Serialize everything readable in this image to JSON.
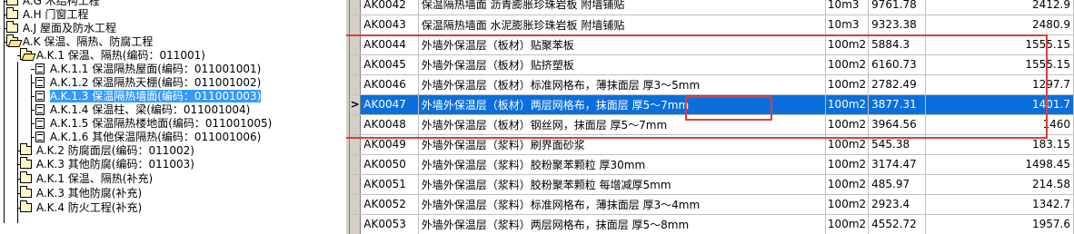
{
  "tree": {
    "items": [
      {
        "label": "A.G 木结构工程",
        "icon": "folder-icon"
      },
      {
        "label": "A.H 门窗工程",
        "icon": "folder-icon"
      },
      {
        "label": "A.J 屋面及防水工程",
        "icon": "folder-icon"
      },
      {
        "label": "A.K 保温、隔热、防腐工程",
        "icon": "folder-open-icon"
      },
      {
        "label": "A.K.1 保温、隔热(编码：011001)",
        "icon": "folder-open-icon"
      },
      {
        "label": "A.K.1.1 保温隔热屋面(编码：011001001)",
        "icon": "document-icon"
      },
      {
        "label": "A.K.1.2 保温隔热天棚(编码：011001002)",
        "icon": "document-icon"
      },
      {
        "label": "A.K.1.3 保温隔热墙面(编码：011001003)",
        "icon": "document-icon",
        "selected": true
      },
      {
        "label": "A.K.1.4 保温柱、梁(编码：011001004)",
        "icon": "document-icon"
      },
      {
        "label": "A.K.1.5 保温隔热楼地面(编码：011001005)",
        "icon": "document-icon"
      },
      {
        "label": "A.K.1.6 其他保温隔热(编码：011001006)",
        "icon": "document-icon"
      },
      {
        "label": "A.K.2 防腐面层(编码：011002)",
        "icon": "folder-icon"
      },
      {
        "label": "A.K.3 其他防腐(编码：011003)",
        "icon": "folder-icon"
      },
      {
        "label": "A.K.1 保温、隔热(补充)",
        "icon": "folder-icon"
      },
      {
        "label": "A.K.3 其他防腐(补充)",
        "icon": "folder-icon"
      },
      {
        "label": "A.K.4 防火工程(补充)",
        "icon": "folder-icon"
      }
    ]
  },
  "grid": {
    "rows": [
      {
        "indicator": "",
        "code": "AK0042",
        "name": "保温隔热墙面 沥青膨胀珍珠岩板 附墙铺贴",
        "unit": "10m3",
        "price": "9761.78",
        "value": "2412.9"
      },
      {
        "indicator": "",
        "code": "AK0043",
        "name": "保温隔热墙面 水泥膨胀珍珠岩板 附墙铺贴",
        "unit": "10m3",
        "price": "9323.38",
        "value": "2480.9"
      },
      {
        "indicator": "",
        "code": "AK0044",
        "name": "外墙外保温层（板材）贴聚苯板",
        "unit": "100m2",
        "price": "5884.3",
        "value": "1555.15"
      },
      {
        "indicator": "",
        "code": "AK0045",
        "name": "外墙外保温层（板材）贴挤塑板",
        "unit": "100m2",
        "price": "6160.73",
        "value": "1555.15"
      },
      {
        "indicator": "",
        "code": "AK0046",
        "name": "外墙外保温层（板材）标准网格布，薄抹面层 厚3～5mm",
        "unit": "100m2",
        "price": "2782.49",
        "value": "1297.7"
      },
      {
        "indicator": ">",
        "code": "AK0047",
        "name": "外墙外保温层（板材）两层网格布，抹面层 厚5～7mm",
        "unit": "100m2",
        "price": "3877.31",
        "value": "1401.7",
        "selected": true
      },
      {
        "indicator": "",
        "code": "AK0048",
        "name": "外墙外保温层（板材）钢丝网，抹面层 厚5～7mm",
        "unit": "100m2",
        "price": "3964.56",
        "value": "1460"
      },
      {
        "indicator": "",
        "code": "AK0049",
        "name": "外墙外保温层（浆料）刷界面砂浆",
        "unit": "100m2",
        "price": "545.38",
        "value": "183.15"
      },
      {
        "indicator": "",
        "code": "AK0050",
        "name": "外墙外保温层（浆料）胶粉聚苯颗粒 厚30mm",
        "unit": "100m2",
        "price": "3174.47",
        "value": "1498.45"
      },
      {
        "indicator": "",
        "code": "AK0051",
        "name": "外墙外保温层（浆料）胶粉聚苯颗粒 每增减厚5mm",
        "unit": "100m2",
        "price": "485.97",
        "value": "214.58"
      },
      {
        "indicator": "",
        "code": "AK0052",
        "name": "外墙外保温层（浆料）标准网格布，薄抹面层 厚3～4mm",
        "unit": "100m2",
        "price": "2923.4",
        "value": "1342.7"
      },
      {
        "indicator": "",
        "code": "AK0053",
        "name": "外墙外保温层（浆料）两层网格布，抹面层 厚5～8mm",
        "unit": "100m2",
        "price": "4552.72",
        "value": "1957.6"
      }
    ]
  },
  "colors": {
    "selection": "#0a6fdc",
    "tree_selection": "#3399ff",
    "annotation": "#e03c3c"
  }
}
